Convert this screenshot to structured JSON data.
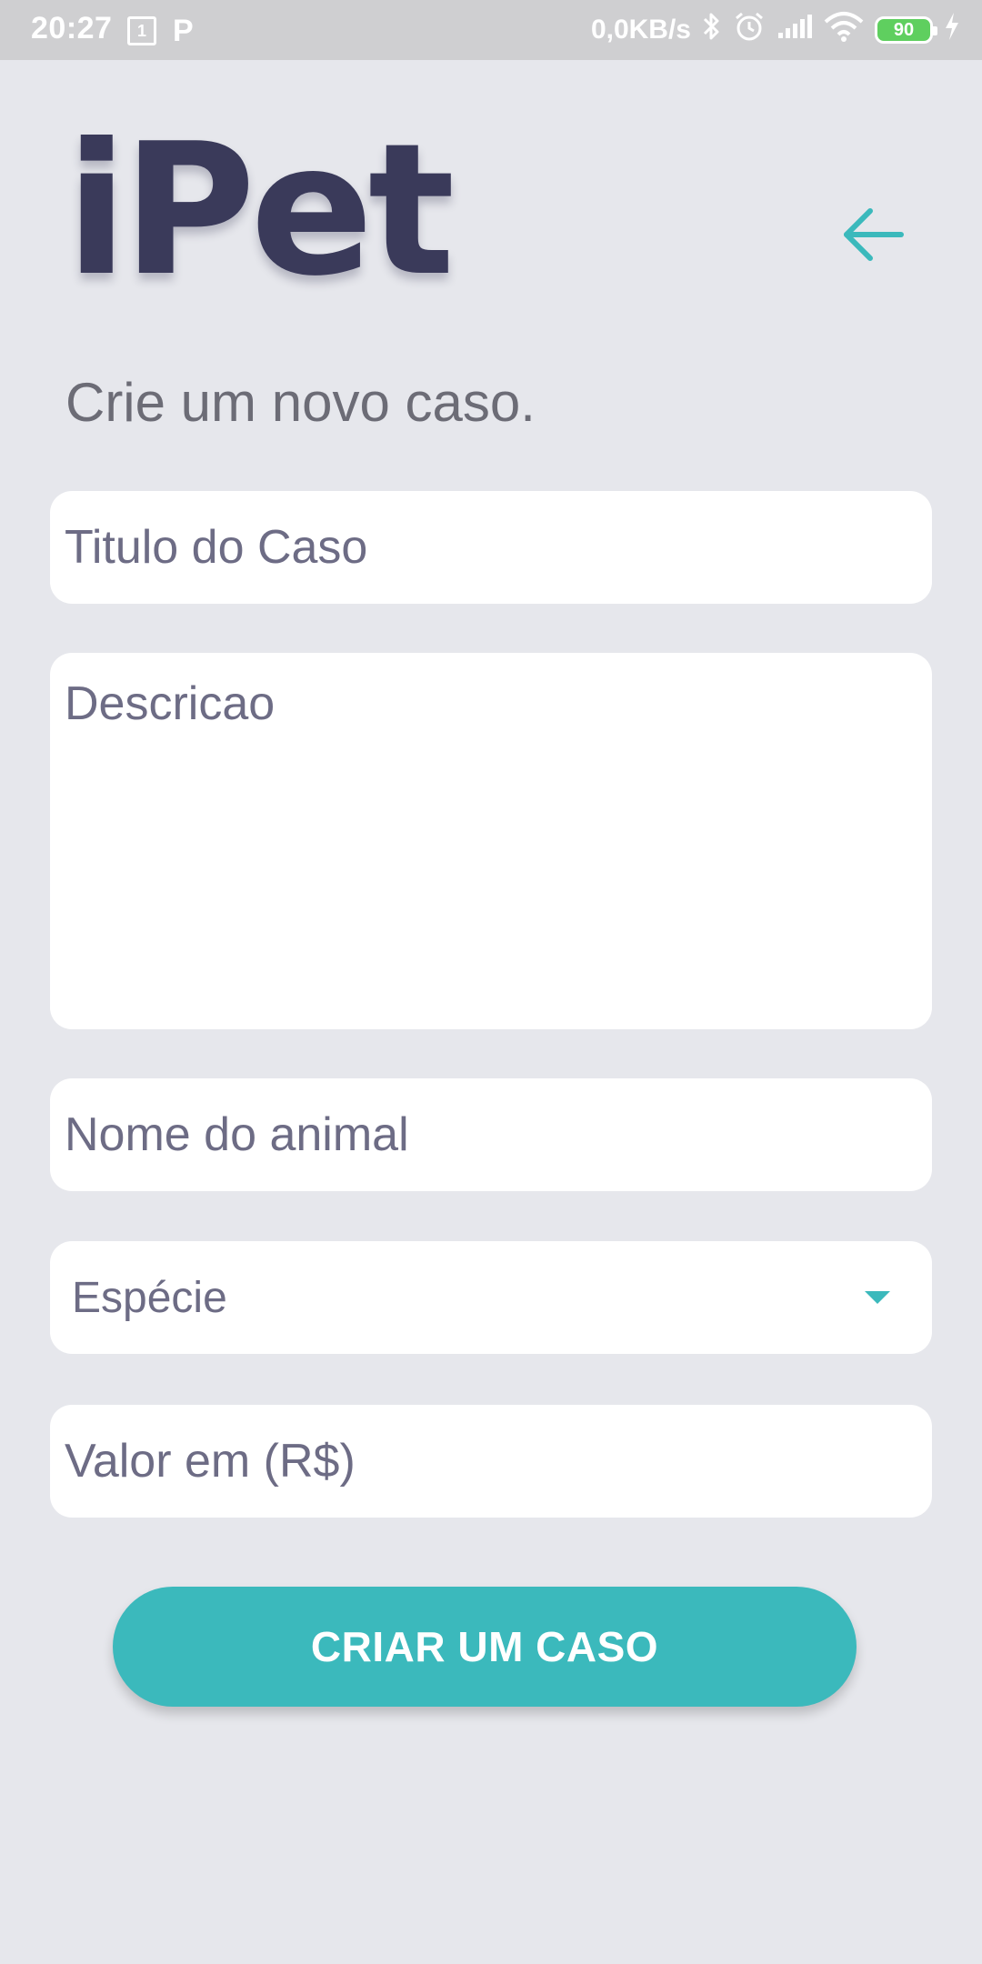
{
  "status_bar": {
    "time": "20:27",
    "sim_label": "1",
    "parking_glyph": "P",
    "network_speed": "0,0KB/s",
    "battery_level": "90",
    "icons": [
      "sim-icon",
      "parking-icon",
      "bluetooth-icon",
      "alarm-icon",
      "signal-icon",
      "wifi-icon",
      "battery-icon",
      "charging-icon"
    ]
  },
  "header": {
    "logo_text": "iPet",
    "back_icon": "arrow-left-icon"
  },
  "page": {
    "subtitle": "Crie um novo caso."
  },
  "form": {
    "title_placeholder": "Titulo do Caso",
    "description_placeholder": "Descricao",
    "animal_name_placeholder": "Nome do animal",
    "species_selected": "Espécie",
    "value_placeholder": "Valor em (R$)",
    "submit_label": "CRIAR UM CASO"
  },
  "colors": {
    "accent": "#3bb9bc",
    "background": "#e6e7ec",
    "logo": "#3a3a5a",
    "text_muted": "#6d6c85"
  }
}
